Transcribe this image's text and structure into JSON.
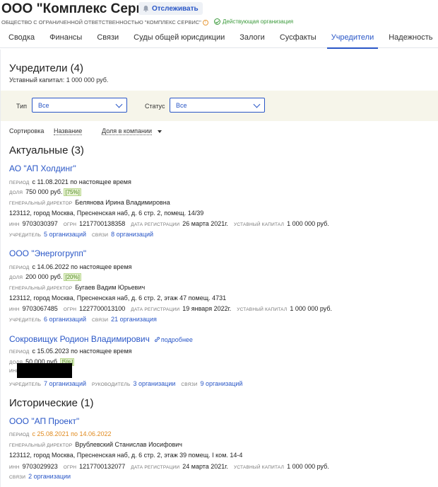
{
  "header": {
    "title": "ООО \"Комплекс Сервис\"",
    "track_label": "Отслеживать",
    "full_name": "ОБЩЕСТВО С ОГРАНИЧЕННОЙ ОТВЕТСТВЕННОСТЬЮ \"КОМПЛЕКС СЕРВИС\"",
    "status": "Действующая организация"
  },
  "tabs": [
    {
      "label": "Сводка"
    },
    {
      "label": "Финансы"
    },
    {
      "label": "Связи"
    },
    {
      "label": "Суды общей юрисдикции"
    },
    {
      "label": "Залоги"
    },
    {
      "label": "Сусфакты"
    },
    {
      "label": "Учредители",
      "active": true
    },
    {
      "label": "Надежность"
    }
  ],
  "founders": {
    "title": "Учредители (4)",
    "capital": "Уставный капитал: 1 000 000 руб."
  },
  "filters": {
    "type_label": "Тип",
    "type_value": "Все",
    "status_label": "Статус",
    "status_value": "Все"
  },
  "sort": {
    "label": "Сортировка",
    "option_name": "Название",
    "option_share": "Доля в компании"
  },
  "labels": {
    "period": "период",
    "share": "доля",
    "director": "генеральный директор",
    "inn": "инн",
    "ogrn": "огрн",
    "reg_date": "дата регистрации",
    "capital": "уставный капитал",
    "founder": "учредитель",
    "links": "связи",
    "head": "руководитель"
  },
  "actual": {
    "title": "Актуальные (3)",
    "entries": [
      {
        "name": "АО \"АП Холдинг\"",
        "period": "с 11.08.2021 по настоящее время",
        "share": "750 000 руб.",
        "share_pct": "75%",
        "director": "Белянова Ирина Владимировна",
        "address": "123112, город Москва, Пресненская наб, д. 6 стр. 2, помещ. 14/39",
        "inn": "9703030397",
        "ogrn": "1217700138358",
        "reg_date": "26 марта 2021г.",
        "capital": "1 000 000 руб.",
        "founder_link": "5 организаций",
        "links_link": "8 организаций"
      },
      {
        "name": "ООО \"Энергогрупп\"",
        "period": "с 14.06.2022 по настоящее время",
        "share": "200 000 руб.",
        "share_pct": "20%",
        "director": "Бугаев Вадим Юрьевич",
        "address": "123112, город Москва, Пресненская наб, д. 6 стр. 2, этаж 47 помещ. 4731",
        "inn": "9703067485",
        "ogrn": "1227700013100",
        "reg_date": "19 января 2022г.",
        "capital": "1 000 000 руб.",
        "founder_link": "6 организаций",
        "links_link": "21 организация"
      },
      {
        "name": "Сокровищук Родион Владимирович",
        "more_label": "подробнее",
        "period": "с 15.05.2023 по настоящее время",
        "share": "50 000 руб.",
        "share_pct": "5%",
        "founder_link": "7 организаций",
        "head_link": "3 организации",
        "links_link": "9 организаций"
      }
    ]
  },
  "historic": {
    "title": "Исторические (1)",
    "entries": [
      {
        "name": "ООО \"АП Проект\"",
        "period": "с 25.08.2021 по 14.06.2022",
        "director": "Врублевский Станислав Иосифович",
        "address": "123112, город Москва, Пресненская наб, д. 6 стр. 2, этаж 39 помещ. I ком. 14-4",
        "inn": "9703029923",
        "ogrn": "1217700132077",
        "reg_date": "24 марта 2021г.",
        "capital": "1 000 000 руб.",
        "links_link": "2 организации"
      }
    ]
  },
  "colors": {
    "accent": "#2a57c7",
    "active_status": "#3b9a3b",
    "historic_period": "#e08a1e",
    "filter_bg": "#f6f5ea"
  }
}
